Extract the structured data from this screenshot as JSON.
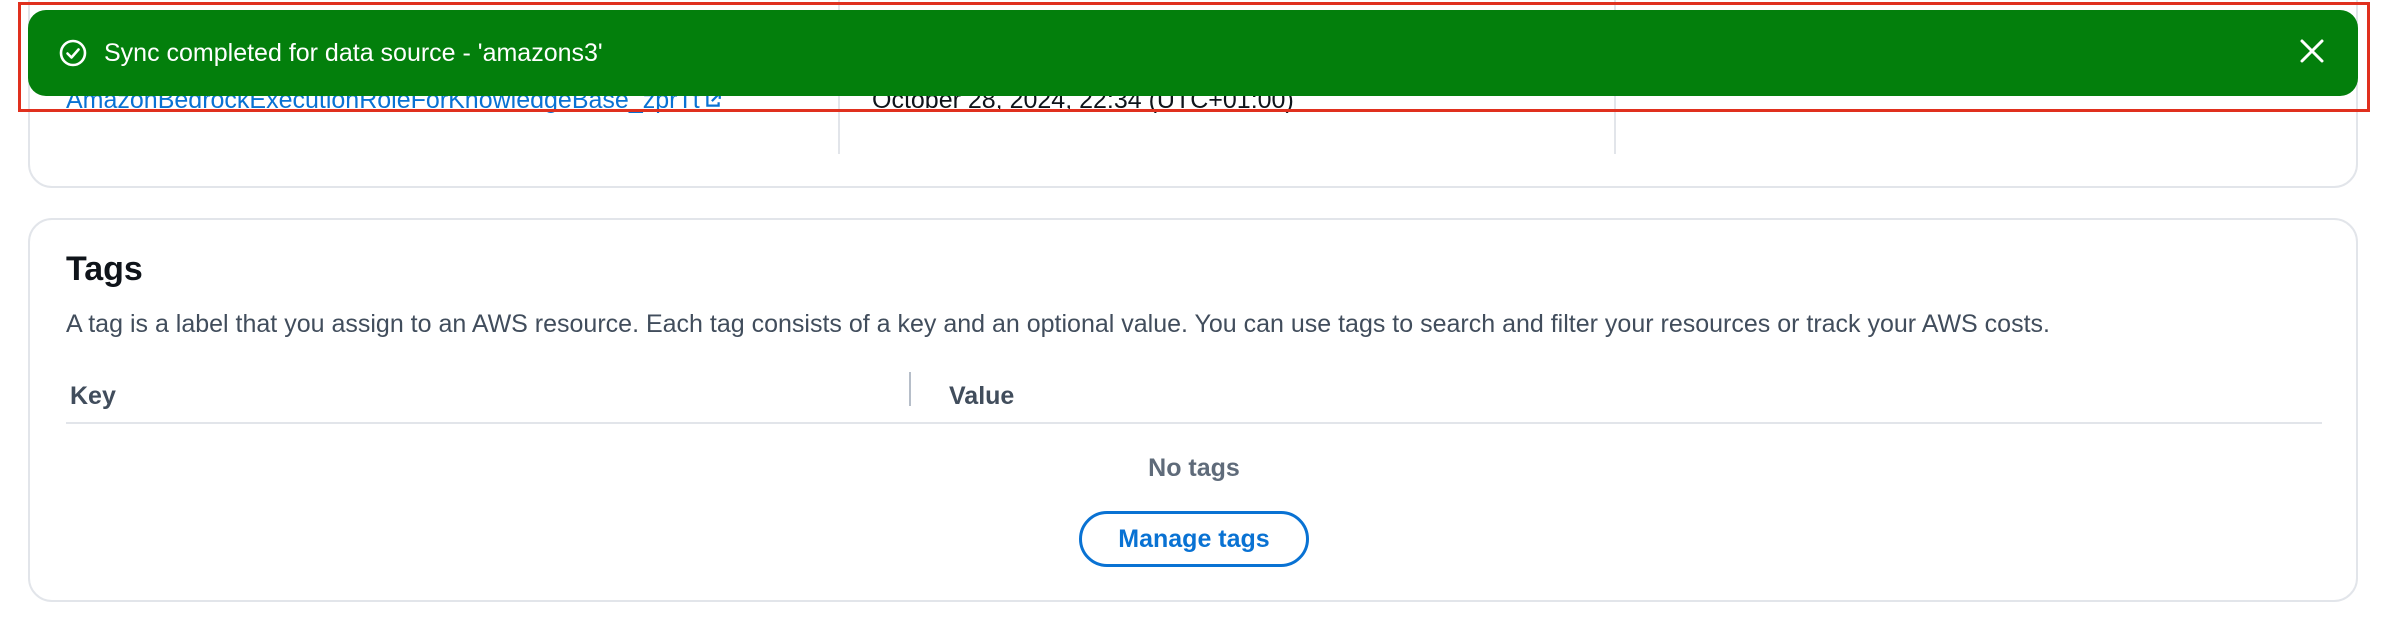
{
  "details": {
    "service_role_link": "AmazonBedrockExecutionRoleForKnowledgeBase_zprTt",
    "created_at": "October 28, 2024, 22:34 (UTC+01:00)"
  },
  "flash": {
    "message": "Sync completed for data source - 'amazons3'",
    "type": "success",
    "color": "#037f0c",
    "icon": "check-circle-icon",
    "dismiss_icon": "close-icon"
  },
  "tags": {
    "title": "Tags",
    "description": "A tag is a label that you assign to an AWS resource. Each tag consists of a key and an optional value. You can use tags to search and filter your resources or track your AWS costs.",
    "columns": [
      "Key",
      "Value"
    ],
    "empty_label": "No tags",
    "manage_button_label": "Manage tags"
  },
  "colors": {
    "link": "#0972d3",
    "border": "#e2e5ea",
    "highlight": "#e0301e"
  }
}
